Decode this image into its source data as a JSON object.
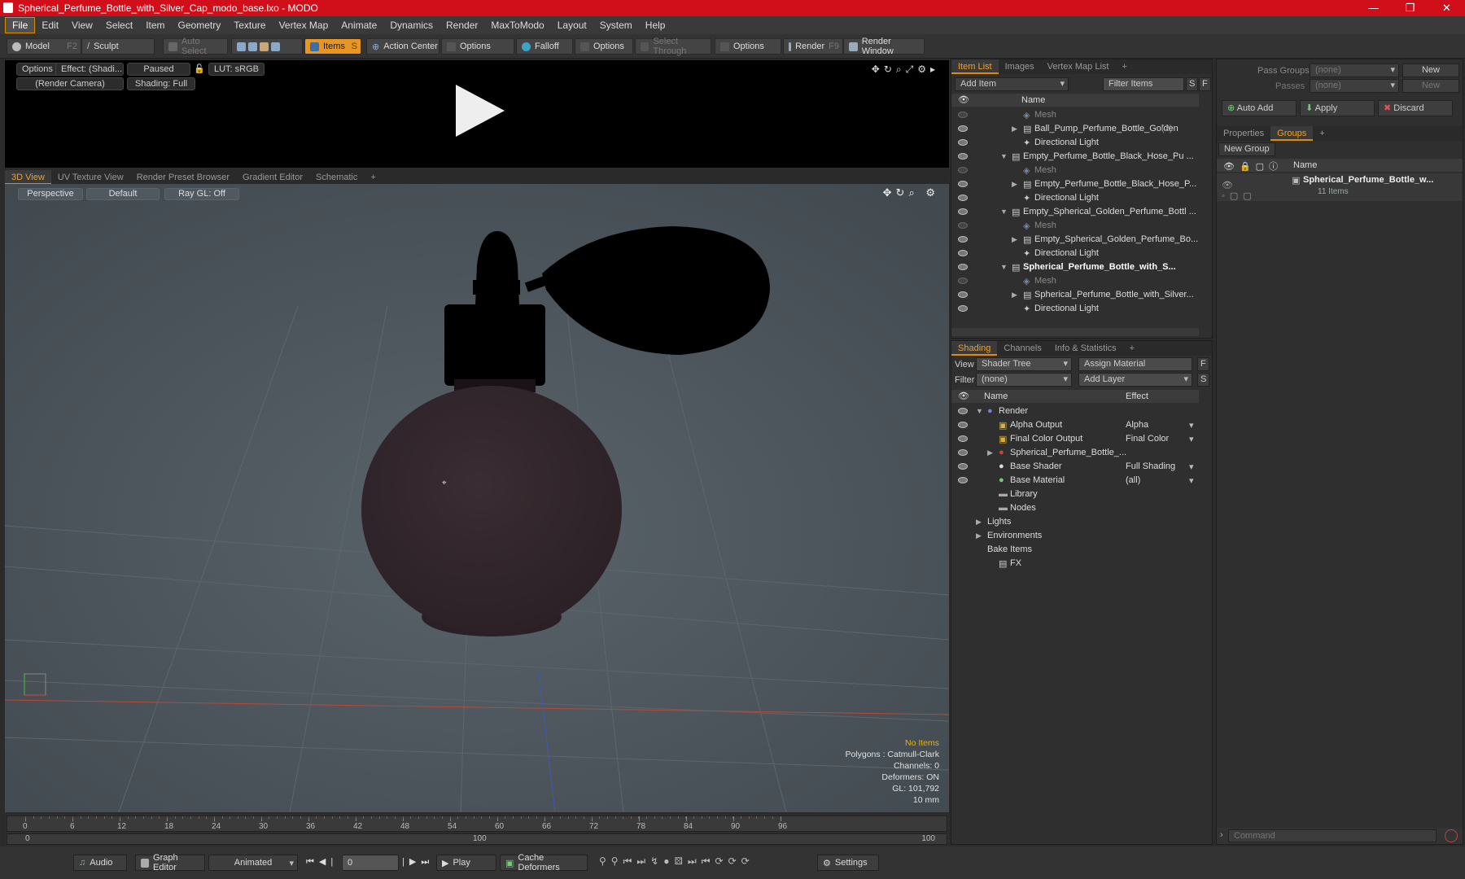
{
  "window": {
    "title": "Spherical_Perfume_Bottle_with_Silver_Cap_modo_base.lxo - MODO"
  },
  "menu": [
    "File",
    "Edit",
    "View",
    "Select",
    "Item",
    "Geometry",
    "Texture",
    "Vertex Map",
    "Animate",
    "Dynamics",
    "Render",
    "MaxToModo",
    "Layout",
    "System",
    "Help"
  ],
  "toolbar": {
    "model": "Model",
    "model_key": "F2",
    "sculpt": "Sculpt",
    "auto_select": "Auto Select",
    "items": "Items",
    "items_key": "S",
    "action_center": "Action Center",
    "options1": "Options",
    "falloff": "Falloff",
    "options2": "Options",
    "select_through": "Select Through",
    "options3": "Options",
    "render": "Render",
    "render_key": "F9",
    "render_window": "Render Window"
  },
  "render_panel": {
    "options": "Options",
    "effect": "Effect: (Shadi...",
    "paused": "Paused",
    "lut": "LUT: sRGB",
    "camera": "(Render Camera)",
    "shading": "Shading: Full"
  },
  "view_tabs": [
    "3D View",
    "UV Texture View",
    "Render Preset Browser",
    "Gradient Editor",
    "Schematic",
    "+"
  ],
  "viewport": {
    "perspective": "Perspective",
    "default": "Default",
    "raygl": "Ray GL: Off",
    "stats": [
      "No Items",
      "Polygons : Catmull-Clark",
      "Channels: 0",
      "Deformers: ON",
      "GL: 101,792",
      "10 mm"
    ]
  },
  "timeline": {
    "ticks": [
      "0",
      "6",
      "12",
      "18",
      "24",
      "30",
      "36",
      "42",
      "48",
      "54",
      "60",
      "66",
      "72",
      "78",
      "84",
      "90",
      "96"
    ],
    "range_start": "0",
    "range_mid": "100",
    "range_end": "100"
  },
  "bottom": {
    "audio": "Audio",
    "graph_editor": "Graph Editor",
    "animated": "Animated",
    "frame": "0",
    "play": "Play",
    "cache": "Cache Deformers",
    "settings": "Settings"
  },
  "item_list": {
    "tabs": [
      "Item List",
      "Images",
      "Vertex Map List",
      "+"
    ],
    "add_item": "Add Item",
    "filter": "Filter Items",
    "s": "S",
    "f": "F",
    "col_name": "Name",
    "rows": [
      {
        "indent": 2,
        "text": "Mesh",
        "kind": "mesh",
        "arrow": ""
      },
      {
        "indent": 2,
        "text": "Ball_Pump_Perfume_Bottle_Golden",
        "extra": "(2)",
        "kind": "item",
        "arrow": "▶"
      },
      {
        "indent": 2,
        "text": "Directional Light",
        "kind": "item",
        "arrow": ""
      },
      {
        "indent": 1,
        "text": "Empty_Perfume_Bottle_Black_Hose_Pu ...",
        "kind": "item",
        "arrow": "▼"
      },
      {
        "indent": 2,
        "text": "Mesh",
        "kind": "mesh",
        "arrow": ""
      },
      {
        "indent": 2,
        "text": "Empty_Perfume_Bottle_Black_Hose_P...",
        "kind": "item",
        "arrow": "▶"
      },
      {
        "indent": 2,
        "text": "Directional Light",
        "kind": "item",
        "arrow": ""
      },
      {
        "indent": 1,
        "text": "Empty_Spherical_Golden_Perfume_Bottl ...",
        "kind": "item",
        "arrow": "▼"
      },
      {
        "indent": 2,
        "text": "Mesh",
        "kind": "mesh",
        "arrow": ""
      },
      {
        "indent": 2,
        "text": "Empty_Spherical_Golden_Perfume_Bo...",
        "kind": "item",
        "arrow": "▶"
      },
      {
        "indent": 2,
        "text": "Directional Light",
        "kind": "item",
        "arrow": ""
      },
      {
        "indent": 1,
        "text": "Spherical_Perfume_Bottle_with_S...",
        "kind": "bold",
        "arrow": "▼"
      },
      {
        "indent": 2,
        "text": "Mesh",
        "kind": "mesh",
        "arrow": ""
      },
      {
        "indent": 2,
        "text": "Spherical_Perfume_Bottle_with_Silver...",
        "kind": "item",
        "arrow": "▶"
      },
      {
        "indent": 2,
        "text": "Directional Light",
        "kind": "item",
        "arrow": ""
      }
    ]
  },
  "shading": {
    "tabs": [
      "Shading",
      "Channels",
      "Info & Statistics",
      "+"
    ],
    "view_label": "View",
    "view_value": "Shader Tree",
    "assign": "Assign Material",
    "f": "F",
    "filter_label": "Filter",
    "filter_value": "(none)",
    "add_layer": "Add Layer",
    "s": "S",
    "col_name": "Name",
    "col_effect": "Effect",
    "rows": [
      {
        "indent": 0,
        "text": "Render",
        "effect": "",
        "arrow": "▼",
        "eye": true
      },
      {
        "indent": 1,
        "text": "Alpha Output",
        "effect": "Alpha",
        "arrow": "",
        "eye": true
      },
      {
        "indent": 1,
        "text": "Final Color Output",
        "effect": "Final Color",
        "arrow": "",
        "eye": true
      },
      {
        "indent": 1,
        "text": "Spherical_Perfume_Bottle_...",
        "effect": "",
        "arrow": "▶",
        "eye": true
      },
      {
        "indent": 1,
        "text": "Base Shader",
        "effect": "Full Shading",
        "arrow": "",
        "eye": true
      },
      {
        "indent": 1,
        "text": "Base Material",
        "effect": "(all)",
        "arrow": "",
        "eye": true
      },
      {
        "indent": 1,
        "text": "Library",
        "effect": "",
        "arrow": "",
        "eye": false
      },
      {
        "indent": 1,
        "text": "Nodes",
        "effect": "",
        "arrow": "",
        "eye": false
      },
      {
        "indent": 0,
        "text": "Lights",
        "effect": "",
        "arrow": "▶",
        "eye": false
      },
      {
        "indent": 0,
        "text": "Environments",
        "effect": "",
        "arrow": "▶",
        "eye": false
      },
      {
        "indent": 0,
        "text": "Bake Items",
        "effect": "",
        "arrow": "",
        "eye": false
      },
      {
        "indent": 1,
        "text": "FX",
        "effect": "",
        "arrow": "",
        "eye": false
      }
    ]
  },
  "groups": {
    "pass_groups": "Pass Groups",
    "pass_value": "(none)",
    "new": "New",
    "passes": "Passes",
    "passes_value": "(none)",
    "new2": "New",
    "auto_add": "Auto Add",
    "apply": "Apply",
    "discard": "Discard",
    "tabs": [
      "Properties",
      "Groups",
      "+"
    ],
    "new_group": "New Group",
    "col_name": "Name",
    "item_name": "Spherical_Perfume_Bottle_w...",
    "item_count": "11 Items"
  },
  "command": {
    "placeholder": "Command"
  }
}
